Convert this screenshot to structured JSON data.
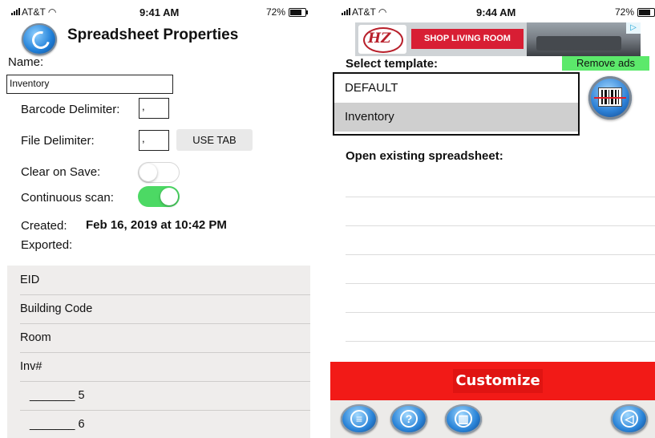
{
  "left_screen": {
    "status": {
      "carrier": "AT&T",
      "time": "9:41 AM",
      "battery": "72%"
    },
    "title": "Spreadsheet Properties",
    "name_label": "Name:",
    "name_value": "Inventory",
    "barcode_delimiter_label": "Barcode Delimiter:",
    "barcode_delimiter_value": ",",
    "file_delimiter_label": "File Delimiter:",
    "file_delimiter_value": ",",
    "use_tab_label": "USE TAB",
    "clear_on_save_label": "Clear on Save:",
    "clear_on_save_on": false,
    "continuous_scan_label": "Continuous scan:",
    "continuous_scan_on": true,
    "created_label": "Created:",
    "created_value": "Feb 16, 2019 at 10:42 PM",
    "exported_label": "Exported:",
    "columns": [
      "EID",
      "Building Code",
      "Room",
      "Inv#",
      "_______ 5",
      "_______ 6"
    ]
  },
  "right_screen": {
    "status": {
      "carrier": "AT&T",
      "time": "9:44 AM",
      "battery": "72%"
    },
    "ad": {
      "logo_text": "HZ",
      "button_text": "SHOP LIVING ROOM",
      "corner_text": "▷"
    },
    "select_template_label": "Select template:",
    "remove_ads_label": "Remove ads",
    "templates": [
      {
        "name": "DEFAULT",
        "selected": false
      },
      {
        "name": "Inventory",
        "selected": true
      }
    ],
    "open_existing_label": "Open existing spreadsheet:",
    "customize_label": "Customize"
  },
  "colors": {
    "toggle_on": "#4cd964",
    "remove_ads_bg": "#5ce96b",
    "customize_bg": "#f21a17",
    "button_blue": "#2a84d8"
  },
  "icons": {
    "back": "back-arrow-icon",
    "scan": "barcode-scan-icon",
    "menu": "menu-icon",
    "help": "help-icon",
    "trash": "trash-icon",
    "sound": "speaker-icon"
  }
}
